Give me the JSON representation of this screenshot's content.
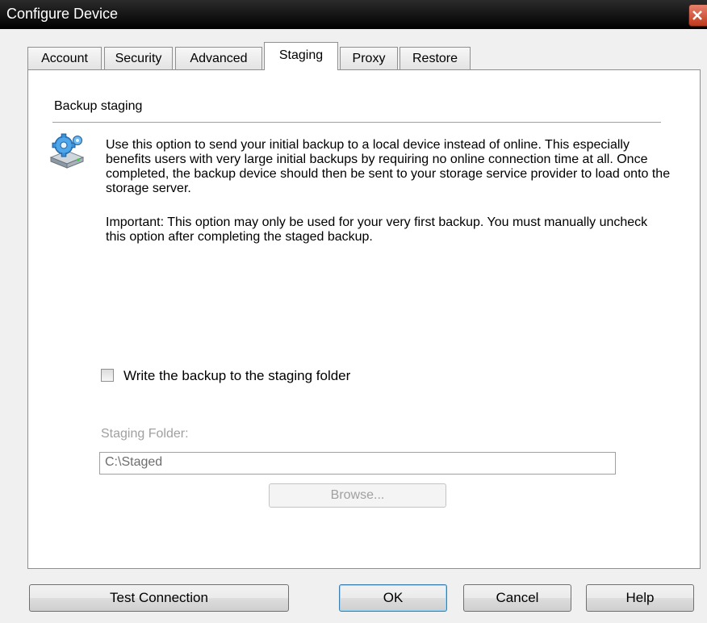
{
  "window": {
    "title": "Configure Device"
  },
  "tabs": [
    {
      "label": "Account"
    },
    {
      "label": "Security"
    },
    {
      "label": "Advanced"
    },
    {
      "label": "Staging"
    },
    {
      "label": "Proxy"
    },
    {
      "label": "Restore"
    }
  ],
  "active_tab": "Staging",
  "staging": {
    "section_title": "Backup staging",
    "icon": "backup-device-gear-icon",
    "description": "Use this option to send your initial backup to a local device instead of online. This especially benefits users with very large initial backups by requiring no online connection time at all. Once completed, the backup device should then be sent to your storage service provider to load onto the storage server.",
    "important": "Important: This option may only be used for your very first backup. You must manually uncheck this option after completing the staged backup.",
    "checkbox_label": "Write the backup to the staging folder",
    "checkbox_checked": false,
    "folder_label": "Staging Folder:",
    "folder_value": "C:\\Staged",
    "browse_label": "Browse..."
  },
  "buttons": {
    "test_connection": "Test Connection",
    "ok": "OK",
    "cancel": "Cancel",
    "help": "Help"
  }
}
